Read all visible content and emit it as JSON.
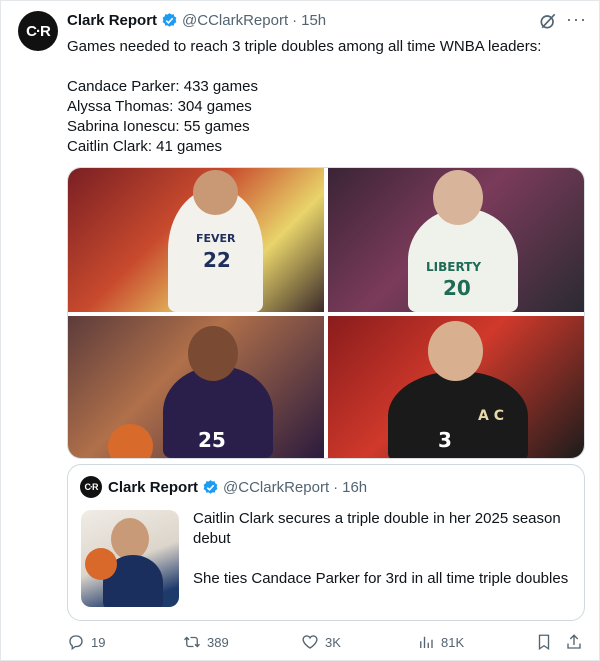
{
  "tweet": {
    "avatar_text": "C·R",
    "author_name": "Clark Report",
    "handle": "@CClarkReport",
    "separator": "·",
    "time": "15h",
    "lines": [
      "Games needed to reach 3 triple doubles among all time WNBA leaders:",
      "",
      "Candace Parker: 433 games",
      "Alyssa Thomas: 304 games",
      "Sabrina Ionescu: 55 games",
      "Caitlin Clark: 41 games"
    ],
    "photos": [
      {
        "jersey_text": "FEVER",
        "number": "22"
      },
      {
        "jersey_text": "LIBERTY",
        "number": "20"
      },
      {
        "jersey_text": "",
        "number": "25"
      },
      {
        "jersey_text": "A C",
        "number": "3"
      }
    ]
  },
  "quote": {
    "avatar_text": "C·R",
    "author_name": "Clark Report",
    "handle": "@CClarkReport",
    "separator": "·",
    "time": "16h",
    "line1": "Caitlin Clark secures a triple double in her 2025 season debut",
    "line2": "She ties Candace Parker for 3rd in all time triple doubles"
  },
  "actions": {
    "replies": "19",
    "reposts": "389",
    "likes": "3K",
    "views": "81K"
  },
  "colors": {
    "verified": "#1d9bf0",
    "secondary_text": "#536471"
  }
}
